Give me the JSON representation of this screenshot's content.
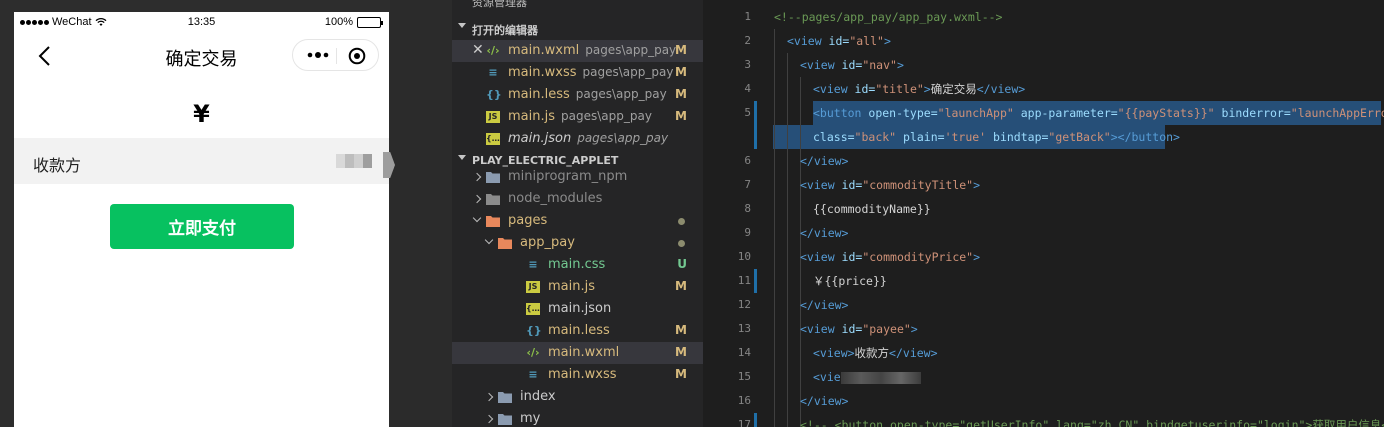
{
  "simulator": {
    "status_bar": {
      "carrier": "WeChat",
      "time": "13:35",
      "battery": "100%"
    },
    "nav": {
      "title": "确定交易"
    },
    "price_symbol": "¥",
    "payee_label": "收款方",
    "pay_button": "立即支付"
  },
  "explorer": {
    "top_title": "资源管理器",
    "open_editors": {
      "title": "打开的编辑器",
      "items": [
        {
          "name": "main.wxml",
          "path": "pages\\app_pay",
          "badge": "M",
          "icon": "wxml-icon",
          "color": "#d7ba7d"
        },
        {
          "name": "main.wxss",
          "path": "pages\\app_pay",
          "badge": "M",
          "icon": "css-icon",
          "color": "#d7ba7d"
        },
        {
          "name": "main.less",
          "path": "pages\\app_pay",
          "badge": "M",
          "icon": "less-icon",
          "color": "#d7ba7d"
        },
        {
          "name": "main.js",
          "path": "pages\\app_pay",
          "badge": "M",
          "icon": "js-icon",
          "color": "#d7ba7d"
        },
        {
          "name": "main.json",
          "path": "pages\\app_pay",
          "badge": "",
          "icon": "json-icon",
          "color": "#cccccc"
        }
      ]
    },
    "project": {
      "title": "PLAY_ELECTRIC_APPLET",
      "tree": [
        {
          "name": "miniprogram_npm",
          "kind": "folder",
          "badge": "",
          "color": "#8b8b8b"
        },
        {
          "name": "node_modules",
          "kind": "folder-node",
          "badge": "",
          "color": "#8b8b8b"
        },
        {
          "name": "pages",
          "kind": "folder-open",
          "badge": "dot",
          "color": "#d7ba7d"
        },
        {
          "name": "app_pay",
          "kind": "folder-open",
          "badge": "dot",
          "color": "#d7ba7d"
        },
        {
          "name": "main.css",
          "kind": "css",
          "badge": "U",
          "color": "#73c991"
        },
        {
          "name": "main.js",
          "kind": "js",
          "badge": "M",
          "color": "#d7ba7d"
        },
        {
          "name": "main.json",
          "kind": "json",
          "badge": "",
          "color": "#cccccc"
        },
        {
          "name": "main.less",
          "kind": "less",
          "badge": "M",
          "color": "#d7ba7d"
        },
        {
          "name": "main.wxml",
          "kind": "wxml",
          "badge": "M",
          "color": "#d7ba7d"
        },
        {
          "name": "main.wxss",
          "kind": "css",
          "badge": "M",
          "color": "#d7ba7d"
        },
        {
          "name": "index",
          "kind": "folder",
          "badge": "",
          "color": "#cccccc"
        },
        {
          "name": "my",
          "kind": "folder",
          "badge": "",
          "color": "#cccccc"
        }
      ]
    }
  },
  "editor": {
    "line_numbers": [
      "1",
      "2",
      "3",
      "4",
      "5",
      "",
      "6",
      "7",
      "8",
      "9",
      "10",
      "11",
      "12",
      "13",
      "14",
      "15",
      "16",
      "17"
    ],
    "lines": [
      {
        "indent": 0,
        "tokens": [
          [
            "cmt",
            "<!--pages/app_pay/app_pay.wxml-->"
          ]
        ]
      },
      {
        "indent": 1,
        "tokens": [
          [
            "tag",
            "<view "
          ],
          [
            "attr",
            "id="
          ],
          [
            "str",
            "\"all\""
          ],
          [
            "tag",
            ">"
          ]
        ]
      },
      {
        "indent": 2,
        "tokens": [
          [
            "tag",
            "<view "
          ],
          [
            "attr",
            "id="
          ],
          [
            "str",
            "\"nav\""
          ],
          [
            "tag",
            ">"
          ]
        ]
      },
      {
        "indent": 3,
        "tokens": [
          [
            "tag",
            "<view "
          ],
          [
            "attr",
            "id="
          ],
          [
            "str",
            "\"title\""
          ],
          [
            "tag",
            ">"
          ],
          [
            "txt",
            "确定交易"
          ],
          [
            "tag",
            "</view>"
          ]
        ]
      },
      {
        "indent": 3,
        "tokens": [
          [
            "tag",
            "<button "
          ],
          [
            "attr",
            "open-type="
          ],
          [
            "str",
            "\"launchApp\""
          ],
          [
            "attr",
            " app-parameter="
          ],
          [
            "str",
            "\"{{payStats}}\""
          ],
          [
            "attr",
            " binderror="
          ],
          [
            "str",
            "\"launchAppError\""
          ]
        ]
      },
      {
        "indent": 3,
        "tokens": [
          [
            "attr",
            "class="
          ],
          [
            "str",
            "\"back\""
          ],
          [
            "attr",
            " plain="
          ],
          [
            "str",
            "'true'"
          ],
          [
            "attr",
            " bindtap="
          ],
          [
            "str",
            "\"getBack\""
          ],
          [
            "tag",
            "></button>"
          ]
        ]
      },
      {
        "indent": 2,
        "tokens": [
          [
            "tag",
            "</view>"
          ]
        ]
      },
      {
        "indent": 2,
        "tokens": [
          [
            "tag",
            "<view "
          ],
          [
            "attr",
            "id="
          ],
          [
            "str",
            "\"commodityTitle\""
          ],
          [
            "tag",
            ">"
          ]
        ]
      },
      {
        "indent": 3,
        "tokens": [
          [
            "txt",
            "{{commodityName}}"
          ]
        ]
      },
      {
        "indent": 2,
        "tokens": [
          [
            "tag",
            "</view>"
          ]
        ]
      },
      {
        "indent": 2,
        "tokens": [
          [
            "tag",
            "<view "
          ],
          [
            "attr",
            "id="
          ],
          [
            "str",
            "\"commodityPrice\""
          ],
          [
            "tag",
            ">"
          ]
        ]
      },
      {
        "indent": 3,
        "tokens": [
          [
            "txt",
            "￥{{price}}"
          ]
        ]
      },
      {
        "indent": 2,
        "tokens": [
          [
            "tag",
            "</view>"
          ]
        ]
      },
      {
        "indent": 2,
        "tokens": [
          [
            "tag",
            "<view "
          ],
          [
            "attr",
            "id="
          ],
          [
            "str",
            "\"payee\""
          ],
          [
            "tag",
            ">"
          ]
        ]
      },
      {
        "indent": 3,
        "tokens": [
          [
            "tag",
            "<view>"
          ],
          [
            "txt",
            "收款方"
          ],
          [
            "tag",
            "</view>"
          ]
        ]
      },
      {
        "indent": 3,
        "tokens": [
          [
            "tag",
            "<vie"
          ],
          [
            "blur",
            ""
          ]
        ]
      },
      {
        "indent": 2,
        "tokens": [
          [
            "tag",
            "</view>"
          ]
        ]
      },
      {
        "indent": 2,
        "tokens": [
          [
            "cmt",
            "<!-- <button open-type=\"getUserInfo\" lang=\"zh_CN\" bindgetuserinfo=\"login\">获取用户信息</"
          ]
        ]
      }
    ]
  }
}
